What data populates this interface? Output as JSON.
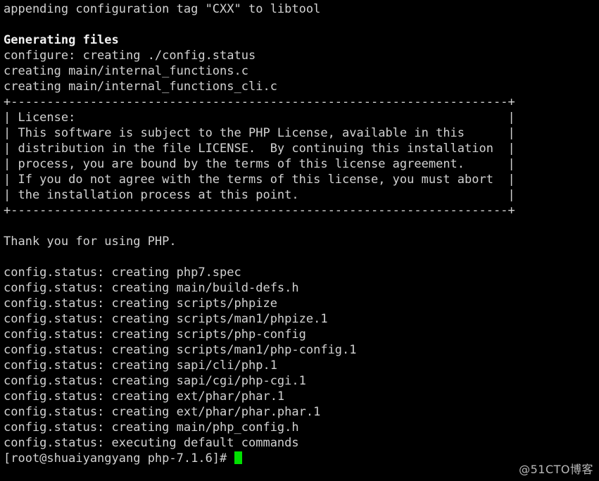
{
  "terminal": {
    "background_color": "#000000",
    "foreground_color": "#d2d2d2",
    "cursor_color": "#00e000",
    "lines": [
      {
        "text": "appending configuration tag \"CXX\" to libtool",
        "style": "normal"
      },
      {
        "text": "",
        "style": "blank"
      },
      {
        "text": "Generating files",
        "style": "bold"
      },
      {
        "text": "configure: creating ./config.status",
        "style": "normal"
      },
      {
        "text": "creating main/internal_functions.c",
        "style": "normal"
      },
      {
        "text": "creating main/internal_functions_cli.c",
        "style": "normal"
      },
      {
        "text": "+---------------------------------------------------------------------+",
        "style": "normal"
      },
      {
        "text": "| License:                                                            |",
        "style": "normal"
      },
      {
        "text": "| This software is subject to the PHP License, available in this      |",
        "style": "normal"
      },
      {
        "text": "| distribution in the file LICENSE.  By continuing this installation  |",
        "style": "normal"
      },
      {
        "text": "| process, you are bound by the terms of this license agreement.      |",
        "style": "normal"
      },
      {
        "text": "| If you do not agree with the terms of this license, you must abort  |",
        "style": "normal"
      },
      {
        "text": "| the installation process at this point.                             |",
        "style": "normal"
      },
      {
        "text": "+---------------------------------------------------------------------+",
        "style": "normal"
      },
      {
        "text": "",
        "style": "blank"
      },
      {
        "text": "Thank you for using PHP.",
        "style": "normal"
      },
      {
        "text": "",
        "style": "blank"
      },
      {
        "text": "config.status: creating php7.spec",
        "style": "normal"
      },
      {
        "text": "config.status: creating main/build-defs.h",
        "style": "normal"
      },
      {
        "text": "config.status: creating scripts/phpize",
        "style": "normal"
      },
      {
        "text": "config.status: creating scripts/man1/phpize.1",
        "style": "normal"
      },
      {
        "text": "config.status: creating scripts/php-config",
        "style": "normal"
      },
      {
        "text": "config.status: creating scripts/man1/php-config.1",
        "style": "normal"
      },
      {
        "text": "config.status: creating sapi/cli/php.1",
        "style": "normal"
      },
      {
        "text": "config.status: creating sapi/cgi/php-cgi.1",
        "style": "normal"
      },
      {
        "text": "config.status: creating ext/phar/phar.1",
        "style": "normal"
      },
      {
        "text": "config.status: creating ext/phar/phar.phar.1",
        "style": "normal"
      },
      {
        "text": "config.status: creating main/php_config.h",
        "style": "normal"
      },
      {
        "text": "config.status: executing default commands",
        "style": "normal"
      }
    ],
    "prompt": {
      "user": "root",
      "host": "shuaiyangyang",
      "directory": "php-7.1.6",
      "text": "[root@shuaiyangyang php-7.1.6]# ",
      "cursor_visible": true
    }
  },
  "watermark": {
    "text": "@51CTO博客"
  }
}
